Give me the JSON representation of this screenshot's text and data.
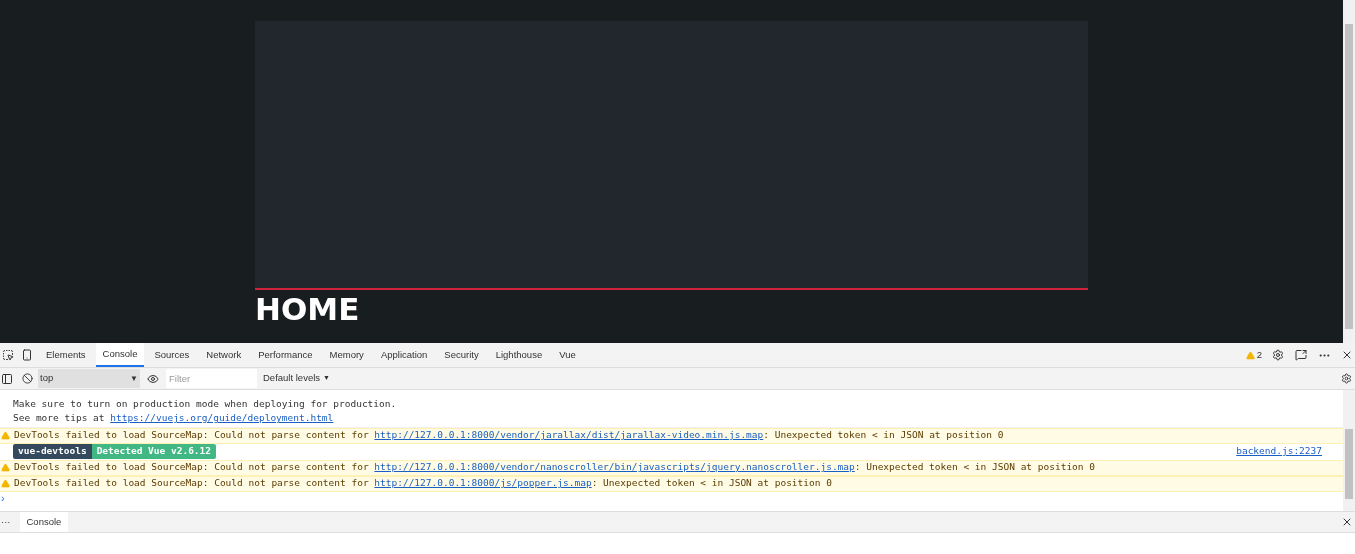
{
  "page": {
    "heading": "HOME"
  },
  "devtools": {
    "tabs": [
      {
        "label": "Elements",
        "selected": false
      },
      {
        "label": "Console",
        "selected": true
      },
      {
        "label": "Sources",
        "selected": false
      },
      {
        "label": "Network",
        "selected": false
      },
      {
        "label": "Performance",
        "selected": false
      },
      {
        "label": "Memory",
        "selected": false
      },
      {
        "label": "Application",
        "selected": false
      },
      {
        "label": "Security",
        "selected": false
      },
      {
        "label": "Lighthouse",
        "selected": false
      },
      {
        "label": "Vue",
        "selected": false
      }
    ],
    "warning_count": "2",
    "toolbar": {
      "context": "top",
      "context_caret": "▼",
      "filter_placeholder": "Filter",
      "levels": "Default levels",
      "levels_caret": "▼"
    },
    "messages": [
      {
        "kind": "info",
        "lines": [
          "Make sure to turn on production mode when deploying for production."
        ],
        "prefix": "See more tips at ",
        "link": "https://vuejs.org/guide/deployment.html"
      },
      {
        "kind": "warning",
        "text": "DevTools failed to load SourceMap: Could not parse content for ",
        "link": "http://127.0.0.1:8000/vendor/jarallax/dist/jarallax-video.min.js.map",
        "suffix": ": Unexpected token < in JSON at position 0"
      },
      {
        "kind": "badge",
        "left": "vue-devtools",
        "right": "Detected Vue v2.6.12",
        "source": "backend.js:2237"
      },
      {
        "kind": "warning",
        "text": "DevTools failed to load SourceMap: Could not parse content for ",
        "link": "http://127.0.0.1:8000/vendor/nanoscroller/bin/javascripts/jquery.nanoscroller.js.map",
        "suffix": ": Unexpected token < in JSON at position 0"
      },
      {
        "kind": "warning",
        "text": "DevTools failed to load SourceMap: Could not parse content for ",
        "link": "http://127.0.0.1:8000/js/popper.js.map",
        "suffix": ": Unexpected token < in JSON at position 0"
      }
    ],
    "prompt": "›",
    "drawer": {
      "more": "···",
      "tabs": [
        {
          "label": "Console",
          "selected": true
        }
      ]
    }
  }
}
